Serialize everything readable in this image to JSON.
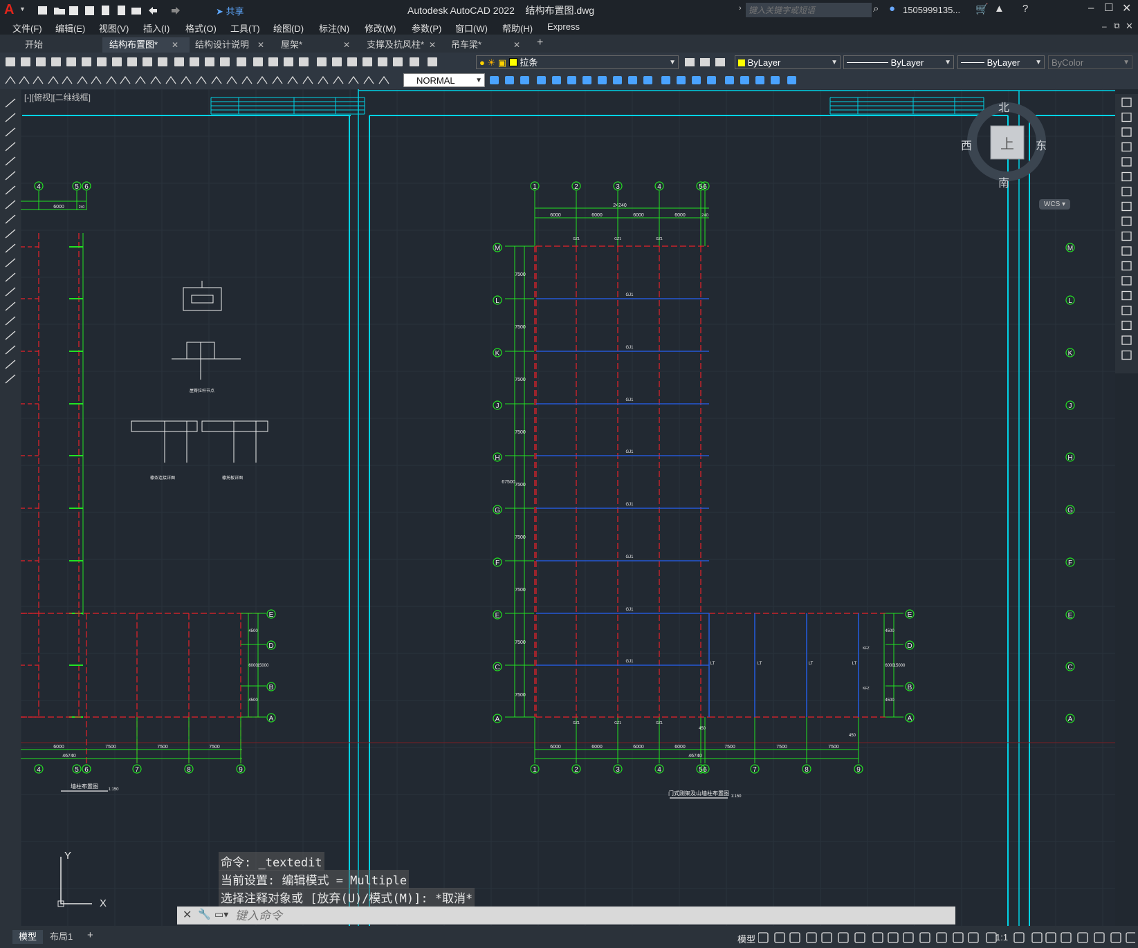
{
  "app": {
    "title": "Autodesk AutoCAD 2022",
    "file": "结构布置图.dwg",
    "share": "共享",
    "search_placeholder": "键入关键字或短语",
    "user": "1505999135...",
    "accent": "#00d3e6"
  },
  "menus": [
    "文件(F)",
    "编辑(E)",
    "视图(V)",
    "插入(I)",
    "格式(O)",
    "工具(T)",
    "绘图(D)",
    "标注(N)",
    "修改(M)",
    "参数(P)",
    "窗口(W)",
    "帮助(H)",
    "Express"
  ],
  "tabs": [
    {
      "label": "开始",
      "active": false,
      "closable": false
    },
    {
      "label": "结构布置图*",
      "active": true,
      "closable": true
    },
    {
      "label": "结构设计说明",
      "active": false,
      "closable": true
    },
    {
      "label": "屋架*",
      "active": false,
      "closable": true
    },
    {
      "label": "支撑及抗风柱*",
      "active": false,
      "closable": true
    },
    {
      "label": "吊车梁*",
      "active": false,
      "closable": true
    }
  ],
  "tab_add": "+",
  "toolbar": {
    "layer": "拉条",
    "color": "ByLayer",
    "linetype": "ByLayer",
    "lineweight": "ByLayer",
    "plotstyle": "ByColor",
    "textstyle": "NORMAL"
  },
  "viewport_label": "[-][俯视][二维线框]",
  "viewcube": {
    "north": "北",
    "south": "南",
    "east": "东",
    "west": "西",
    "top": "上",
    "wcs": "WCS"
  },
  "ucs": {
    "x": "X",
    "y": "Y"
  },
  "drawing": {
    "left_title": "墙柱布置图",
    "left_scale": "1:150",
    "main_title": "门式刚架及山墙柱布置图",
    "main_scale": "1:150",
    "grid_cols": [
      "1",
      "2",
      "3",
      "4",
      "5",
      "6",
      "7",
      "8",
      "9"
    ],
    "grid_rows": [
      "M",
      "L",
      "K",
      "J",
      "H",
      "G",
      "F",
      "E",
      "C",
      "A"
    ],
    "small_rows": [
      "E",
      "D",
      "B",
      "A"
    ],
    "bay_dims": [
      "6000",
      "6000",
      "6000",
      "6000",
      "240"
    ],
    "end_dims": [
      "7500",
      "7500",
      "7500"
    ],
    "total_top": "24240",
    "total_bottom": "46740",
    "total_left": "67500",
    "row_dim": "7500",
    "right_small_dims": [
      "4500",
      "6000",
      "4500"
    ],
    "right_small_total": "15000",
    "beam_label": "GJ1",
    "tie_label": "LT",
    "col_tag": "GZ1",
    "col_small": "KFZ",
    "brace_tag": "XG",
    "dim450": "450",
    "dim240": "240",
    "detail_a": "屋脊拉杆节点",
    "detail_b": "檩条连接详图",
    "detail_c": "檩托板详图"
  },
  "command": {
    "line1": "命令: _textedit",
    "line2": "当前设置: 编辑模式 = Multiple",
    "line3": "选择注释对象或 [放弃(U)/模式(M)]: *取消*",
    "placeholder": "键入命令"
  },
  "layout_tabs": [
    "模型",
    "布局1"
  ],
  "status": {
    "model": "模型",
    "scale": "1:1"
  }
}
